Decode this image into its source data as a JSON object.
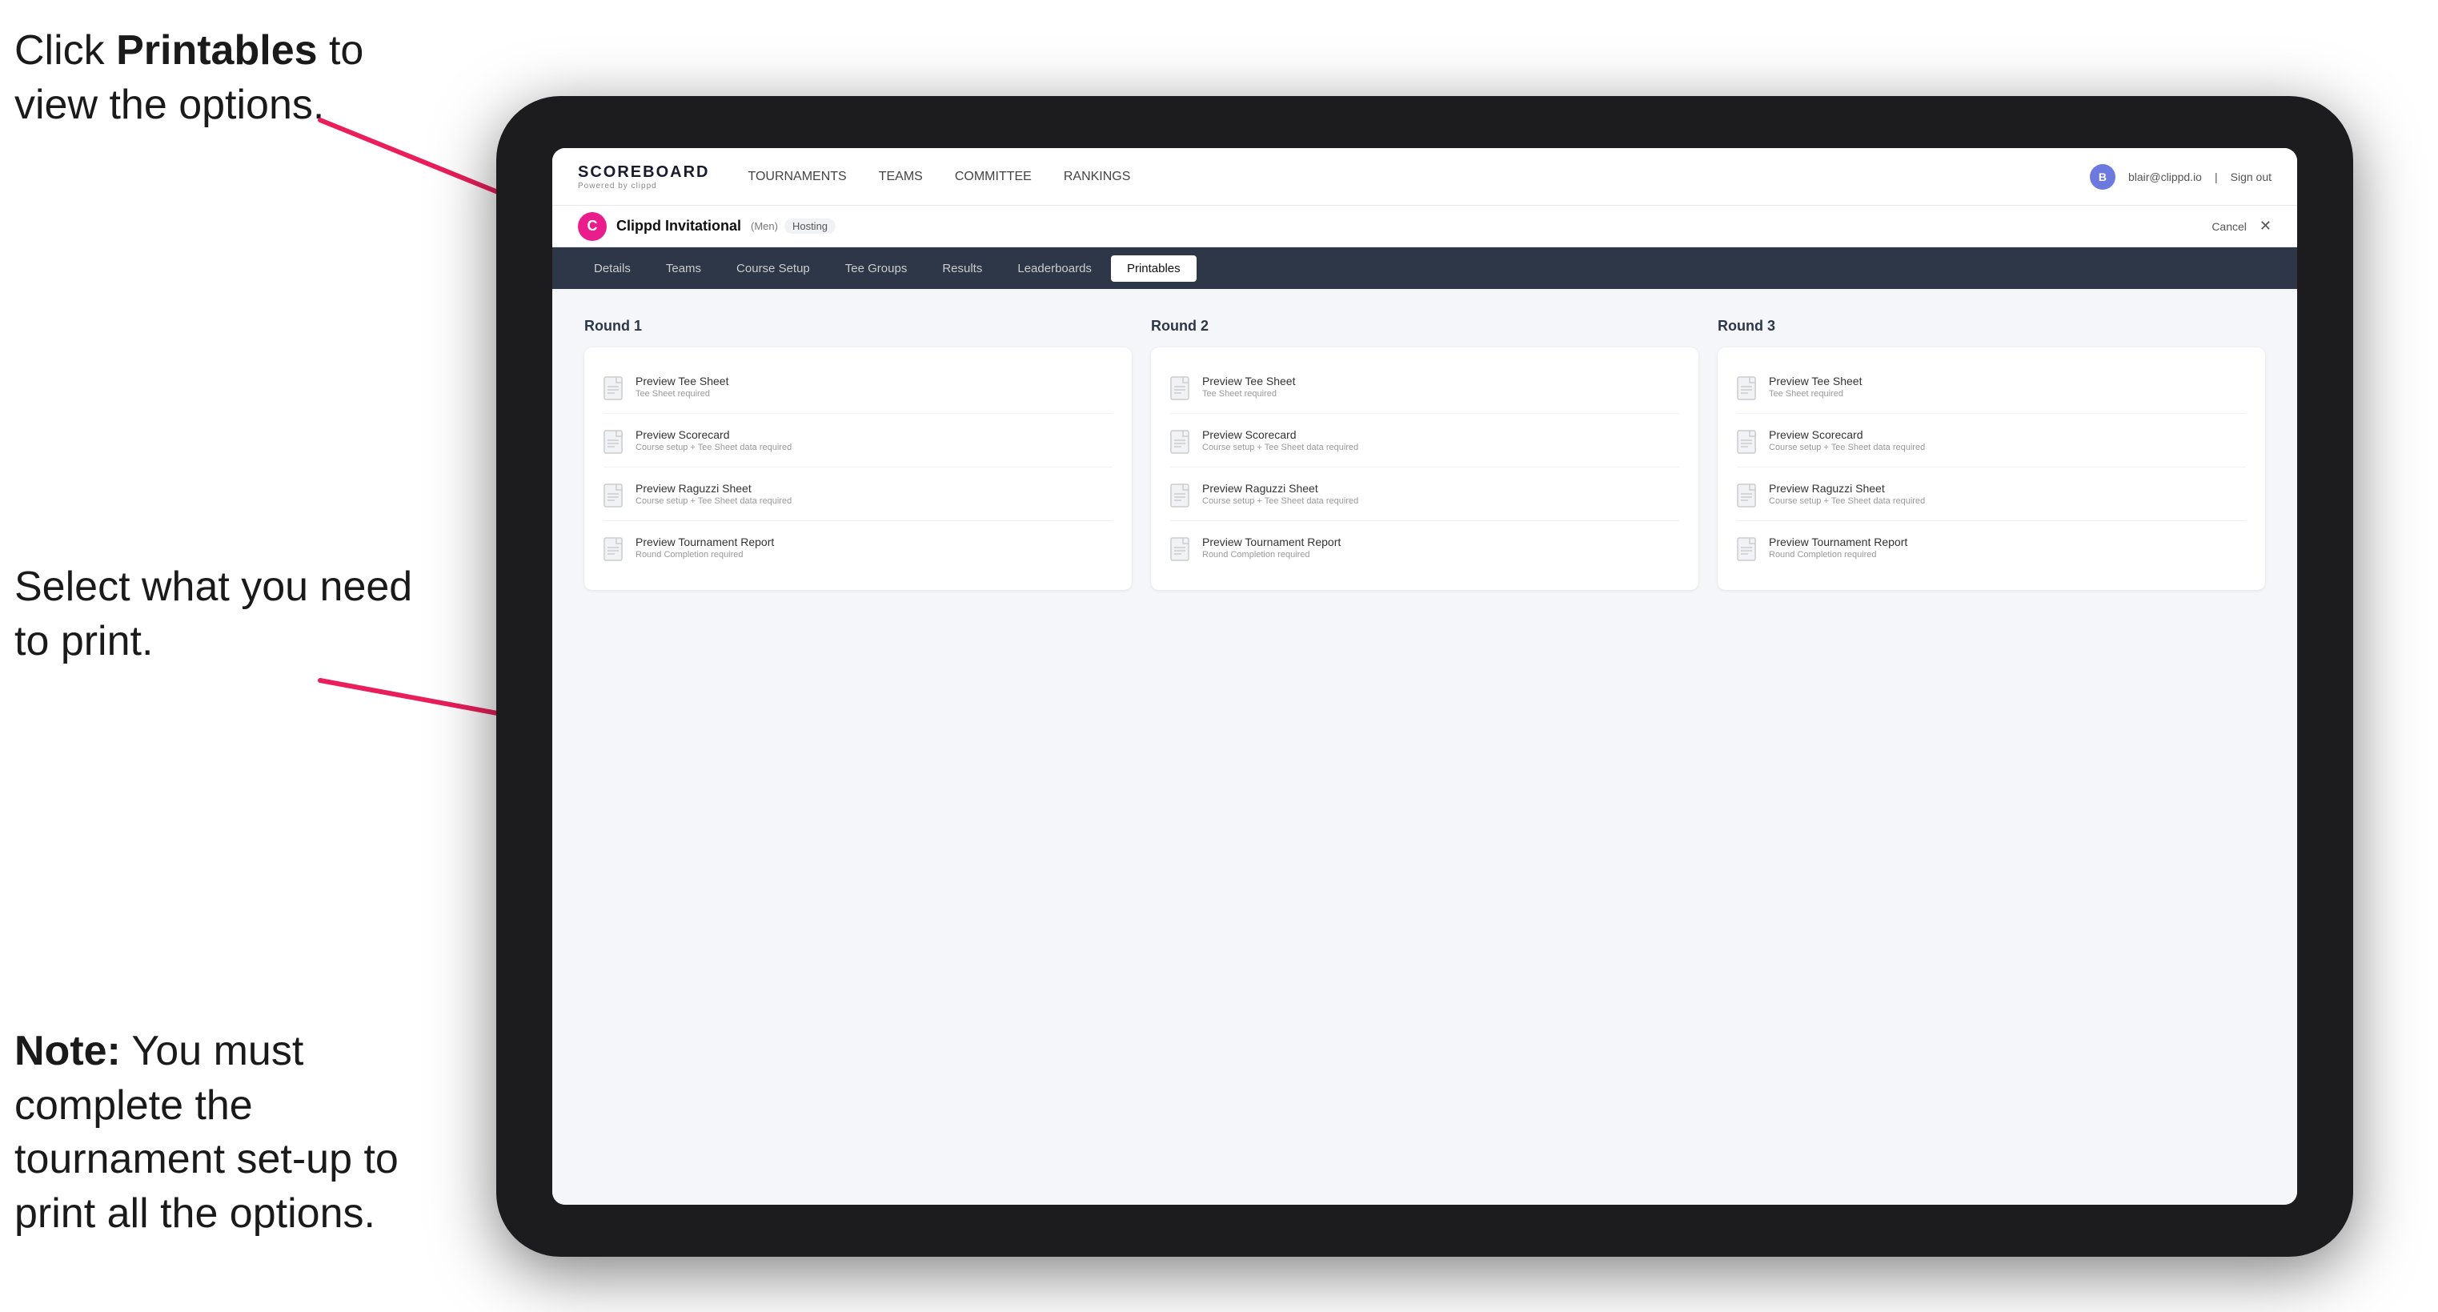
{
  "annotations": {
    "top": {
      "text_before": "Click ",
      "bold": "Printables",
      "text_after": " to view the options."
    },
    "middle": {
      "text": "Select what you need to print."
    },
    "bottom": {
      "bold": "Note:",
      "text": " You must complete the tournament set-up to print all the options."
    }
  },
  "nav": {
    "logo_title": "SCOREBOARD",
    "logo_sub": "Powered by clippd",
    "links": [
      {
        "label": "TOURNAMENTS",
        "active": false
      },
      {
        "label": "TEAMS",
        "active": false
      },
      {
        "label": "COMMITTEE",
        "active": false
      },
      {
        "label": "RANKINGS",
        "active": false
      }
    ],
    "user_email": "blair@clippd.io",
    "sign_out": "Sign out",
    "user_initial": "B"
  },
  "tournament_bar": {
    "logo_letter": "C",
    "name": "Clippd Invitational",
    "tag": "(Men)",
    "status": "Hosting",
    "cancel": "Cancel"
  },
  "tabs": [
    {
      "label": "Details",
      "active": false
    },
    {
      "label": "Teams",
      "active": false
    },
    {
      "label": "Course Setup",
      "active": false
    },
    {
      "label": "Tee Groups",
      "active": false
    },
    {
      "label": "Results",
      "active": false
    },
    {
      "label": "Leaderboards",
      "active": false
    },
    {
      "label": "Printables",
      "active": true
    }
  ],
  "rounds": [
    {
      "title": "Round 1",
      "items": [
        {
          "title": "Preview Tee Sheet",
          "sub": "Tee Sheet required"
        },
        {
          "title": "Preview Scorecard",
          "sub": "Course setup + Tee Sheet data required"
        },
        {
          "title": "Preview Raguzzi Sheet",
          "sub": "Course setup + Tee Sheet data required"
        },
        {
          "title": "Preview Tournament Report",
          "sub": "Round Completion required"
        }
      ]
    },
    {
      "title": "Round 2",
      "items": [
        {
          "title": "Preview Tee Sheet",
          "sub": "Tee Sheet required"
        },
        {
          "title": "Preview Scorecard",
          "sub": "Course setup + Tee Sheet data required"
        },
        {
          "title": "Preview Raguzzi Sheet",
          "sub": "Course setup + Tee Sheet data required"
        },
        {
          "title": "Preview Tournament Report",
          "sub": "Round Completion required"
        }
      ]
    },
    {
      "title": "Round 3",
      "items": [
        {
          "title": "Preview Tee Sheet",
          "sub": "Tee Sheet required"
        },
        {
          "title": "Preview Scorecard",
          "sub": "Course setup + Tee Sheet data required"
        },
        {
          "title": "Preview Raguzzi Sheet",
          "sub": "Course setup + Tee Sheet data required"
        },
        {
          "title": "Preview Tournament Report",
          "sub": "Round Completion required"
        }
      ]
    }
  ]
}
